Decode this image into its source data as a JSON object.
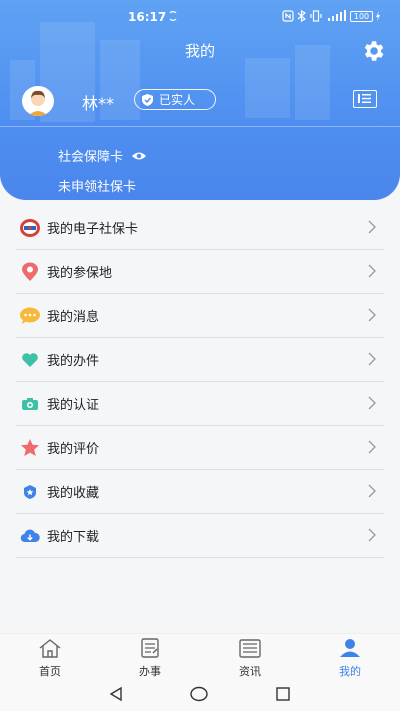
{
  "status": {
    "time": "16:17",
    "battery": "100"
  },
  "header": {
    "title": "我的"
  },
  "user": {
    "name": "林**",
    "verified_label": "已实人"
  },
  "card": {
    "label": "社会保障卡",
    "status": "未申领社保卡"
  },
  "menu": [
    {
      "label": "我的电子社保卡",
      "icon": "social-card-icon"
    },
    {
      "label": "我的参保地",
      "icon": "location-pin-icon"
    },
    {
      "label": "我的消息",
      "icon": "message-icon"
    },
    {
      "label": "我的办件",
      "icon": "heart-icon"
    },
    {
      "label": "我的认证",
      "icon": "camera-icon"
    },
    {
      "label": "我的评价",
      "icon": "star-icon"
    },
    {
      "label": "我的收藏",
      "icon": "favorite-icon"
    },
    {
      "label": "我的下载",
      "icon": "cloud-download-icon"
    }
  ],
  "tabs": [
    {
      "label": "首页",
      "icon": "home-icon"
    },
    {
      "label": "办事",
      "icon": "task-icon"
    },
    {
      "label": "资讯",
      "icon": "news-icon"
    },
    {
      "label": "我的",
      "icon": "profile-icon",
      "active": true
    }
  ],
  "colors": {
    "header": "#4f8ff0",
    "accent": "#3f82e8"
  }
}
